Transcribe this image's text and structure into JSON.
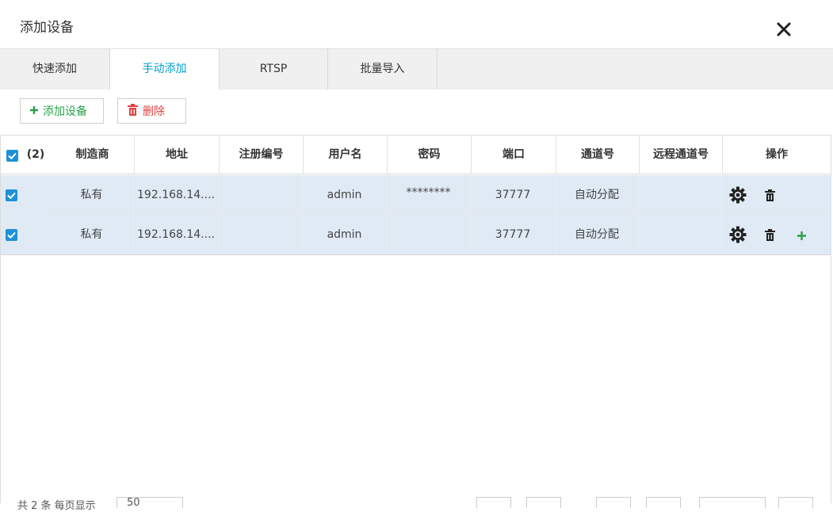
{
  "dialog": {
    "title": "添加设备"
  },
  "tabs": [
    {
      "label": "快速添加"
    },
    {
      "label": "手动添加"
    },
    {
      "label": "RTSP"
    },
    {
      "label": "批量导入"
    }
  ],
  "toolbar": {
    "add_label": "添加设备",
    "delete_label": "删除"
  },
  "table": {
    "selected_count": "(2)",
    "headers": [
      "制造商",
      "地址",
      "注册编号",
      "用户名",
      "密码",
      "端口",
      "通道号",
      "远程通道号",
      "操作"
    ],
    "rows": [
      {
        "checked": true,
        "manufacturer": "私有",
        "address": "192.168.14....",
        "reg_no": "",
        "username": "admin",
        "password": "********",
        "port": "37777",
        "channel": "自动分配",
        "remote_channel": ""
      },
      {
        "checked": true,
        "manufacturer": "私有",
        "address": "192.168.14....",
        "reg_no": "",
        "username": "admin",
        "password": "",
        "port": "37777",
        "channel": "自动分配",
        "remote_channel": ""
      }
    ]
  },
  "footer": {
    "summary": "共 2 条 每页显示",
    "page_size": "50"
  },
  "colors": {
    "accent": "#00a0d2",
    "selected_row": "#dfeaf5",
    "add_green": "#2aa04a",
    "delete_red": "#e04040",
    "checkbox_blue": "#1e90d8"
  },
  "icons": {
    "close": "close-icon",
    "plus": "plus-icon",
    "trash": "trash-icon",
    "gear": "gear-icon",
    "check": "check-icon"
  }
}
